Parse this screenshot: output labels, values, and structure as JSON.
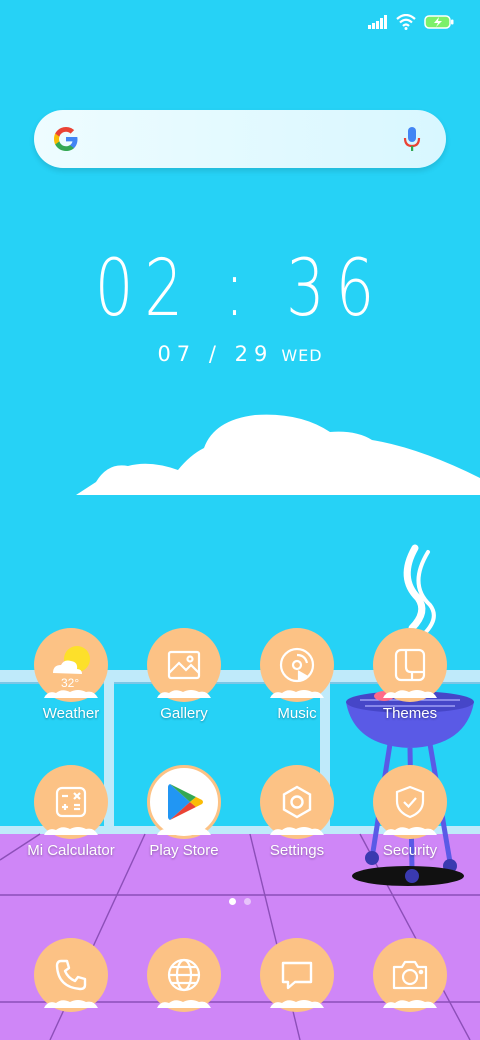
{
  "status_bar": {
    "icons": [
      "signal-icon",
      "wifi-icon",
      "battery-charging-icon"
    ]
  },
  "search": {
    "logo": "google-g-logo",
    "placeholder": "",
    "mic_icon": "mic-icon"
  },
  "clock": {
    "time": "02 : 36",
    "date": "07 / 29",
    "day": "WED"
  },
  "apps_row1": [
    {
      "label": "Weather",
      "icon": "weather-icon",
      "temp": "32°"
    },
    {
      "label": "Gallery",
      "icon": "gallery-icon"
    },
    {
      "label": "Music",
      "icon": "music-icon"
    },
    {
      "label": "Themes",
      "icon": "themes-icon"
    }
  ],
  "apps_row2": [
    {
      "label": "Mi Calculator",
      "icon": "calculator-icon"
    },
    {
      "label": "Play Store",
      "icon": "play-store-icon"
    },
    {
      "label": "Settings",
      "icon": "settings-icon"
    },
    {
      "label": "Security",
      "icon": "security-icon"
    }
  ],
  "page_indicator": {
    "pages": 2,
    "current": 1
  },
  "dock": [
    {
      "icon": "phone-icon"
    },
    {
      "icon": "browser-icon"
    },
    {
      "icon": "messages-icon"
    },
    {
      "icon": "camera-icon"
    }
  ],
  "colors": {
    "sky": "#26d2f6",
    "floor": "#cf86f7",
    "icon_bg": "#fcc285",
    "grill": "#5a5ae6"
  }
}
